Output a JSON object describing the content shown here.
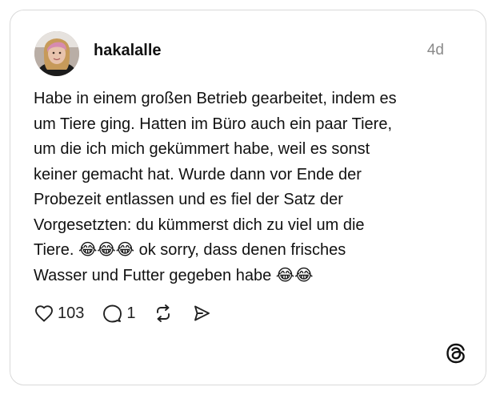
{
  "post": {
    "username": "hakalalle",
    "timestamp": "4d",
    "text": "Habe in einem großen Betrieb gearbeitet, indem es\num Tiere ging. Hatten im Büro auch ein paar Tiere,\num die ich mich gekümmert habe, weil es sonst\nkeiner gemacht hat. Wurde dann vor Ende der\nProbezeit entlassen und es fiel der Satz der\nVorgesetzten: du kümmerst dich zu viel um die\nTiere. 😂😂😂 ok sorry, dass denen frisches\nWasser und Futter gegeben habe 😂😂"
  },
  "actions": {
    "like_count": "103",
    "reply_count": "1"
  },
  "icons": {
    "like": "heart-icon",
    "reply": "comment-bubble-icon",
    "repost": "repost-icon",
    "share": "send-icon",
    "brand": "threads-logo-icon"
  },
  "colors": {
    "text": "#111111",
    "muted": "#8a8a8a",
    "border": "#d9d9d9"
  }
}
